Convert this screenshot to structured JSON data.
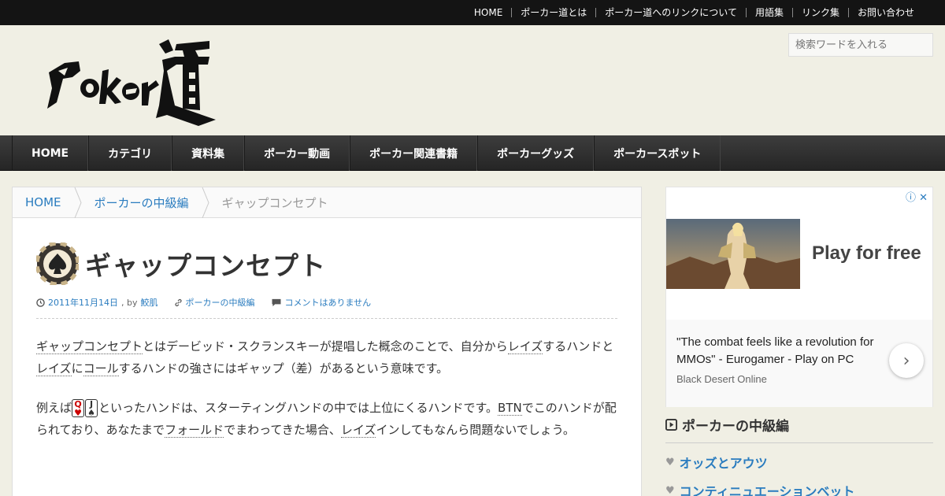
{
  "topnav": [
    "HOME",
    "ポーカー道とは",
    "ポーカー道へのリンクについて",
    "用語集",
    "リンク集",
    "お問い合わせ"
  ],
  "search": {
    "placeholder": "検索ワードを入れる"
  },
  "logo_text": "Poker道",
  "mainnav": [
    "HOME",
    "カテゴリ",
    "資料集",
    "ポーカー動画",
    "ポーカー関連書籍",
    "ポーカーグッズ",
    "ポーカースポット"
  ],
  "breadcrumb": {
    "home": "HOME",
    "category": "ポーカーの中級編",
    "current": "ギャップコンセプト"
  },
  "post": {
    "title": "ギャップコンセプト",
    "date": "2011年11月14日",
    "by": ", by",
    "author": "鮫肌",
    "category": "ポーカーの中級編",
    "comments": "コメントはありません",
    "p1": {
      "t1": "ギャップコンセプト",
      "t2": "とはデービッド・スクランスキーが提唱した概念のことで、自分から",
      "t3": "レイズ",
      "t4": "するハンドと",
      "t5": "レイズ",
      "t6": "に",
      "t7": "コール",
      "t8": "するハンドの強さにはギャップ（差）があるという意味です。"
    },
    "p2": {
      "t1": "例えば",
      "card1_rank": "Q",
      "card1_suit": "♥",
      "card2_rank": "J",
      "card2_suit": "♠",
      "t2": "といったハンドは、スターティングハンドの中では上位にくるハンドです。",
      "t3": "BTN",
      "t4": "でこのハンドが配られており、あなたまで",
      "t5": "フォールド",
      "t6": "でまわってきた場合、",
      "t7": "レイズ",
      "t8": "インしてもなんら問題ないでしょう。"
    }
  },
  "ad": {
    "headline": "Play for free",
    "quote": "\"The combat feels like a revolution for MMOs\" - Eurogamer - Play on PC",
    "brand": "Black Desert Online"
  },
  "sidebar": {
    "heading": "ポーカーの中級編",
    "items": [
      "オッズとアウツ",
      "コンティニュエーションベット"
    ]
  },
  "colors": {
    "link": "#2a7cbf",
    "topbar": "#141414",
    "nav": "#2e2e2e",
    "background": "#f0efe4"
  }
}
